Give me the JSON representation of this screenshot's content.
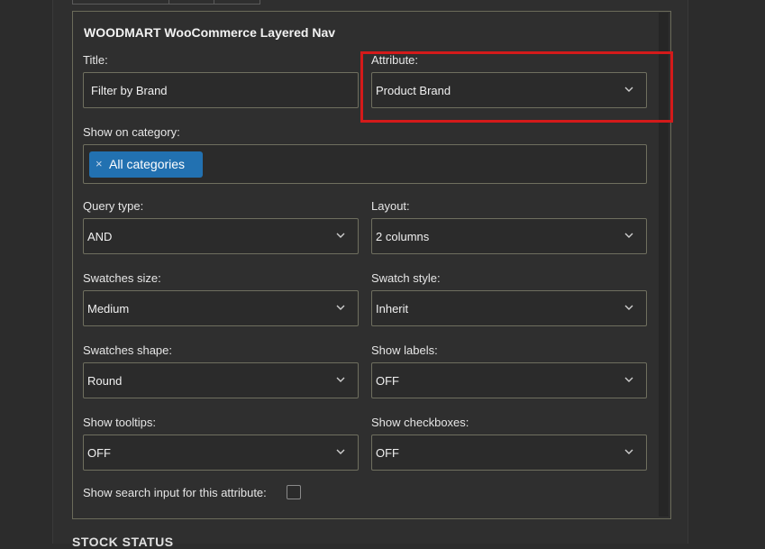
{
  "widget": {
    "title": "WOODMART WooCommerce Layered Nav",
    "title_field": {
      "label": "Title:",
      "value": "Filter by Brand"
    },
    "attribute": {
      "label": "Attribute:",
      "value": "Product Brand"
    },
    "show_on_category": {
      "label": "Show on category:",
      "tag_remove": "×",
      "tag": "All categories"
    },
    "query_type": {
      "label": "Query type:",
      "value": "AND"
    },
    "layout": {
      "label": "Layout:",
      "value": "2 columns"
    },
    "swatches_size": {
      "label": "Swatches size:",
      "value": "Medium"
    },
    "swatch_style": {
      "label": "Swatch style:",
      "value": "Inherit"
    },
    "swatches_shape": {
      "label": "Swatches shape:",
      "value": "Round"
    },
    "show_labels": {
      "label": "Show labels:",
      "value": "OFF"
    },
    "show_tooltips": {
      "label": "Show tooltips:",
      "value": "OFF"
    },
    "show_checkboxes": {
      "label": "Show checkboxes:",
      "value": "OFF"
    },
    "search_input": {
      "label": "Show search input for this attribute:",
      "checked": false
    }
  },
  "next_section": {
    "title": "STOCK STATUS"
  },
  "colors": {
    "accent": "#2271b1",
    "highlight": "#d41a1a",
    "border": "#6f6f5f",
    "background": "#2c2c2c"
  },
  "icons": {
    "dropdown": "chevron-down-icon",
    "remove": "close-icon"
  }
}
